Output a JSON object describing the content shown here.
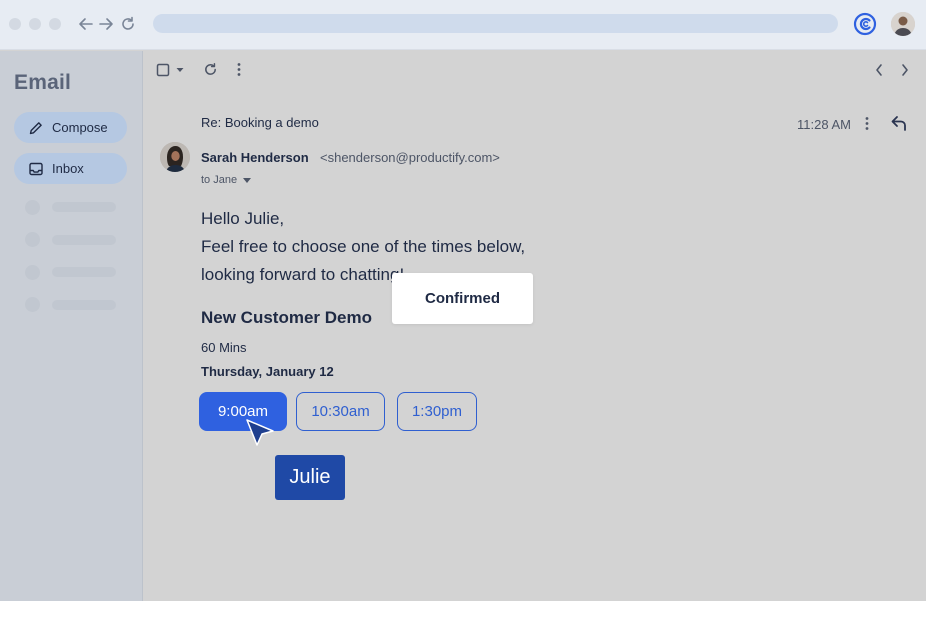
{
  "browser": {
    "icons": [
      "arrow-left-icon",
      "arrow-right-icon",
      "reload-icon",
      "brand-logo-icon",
      "user-avatar"
    ]
  },
  "sidebar": {
    "title": "Email",
    "compose_label": "Compose",
    "inbox_label": "Inbox",
    "placeholder_items": 4
  },
  "toolbar": {
    "icons": [
      "checkbox-icon",
      "dropdown-caret-icon",
      "refresh-icon",
      "more-vertical-icon",
      "chevron-left-icon",
      "chevron-right-icon"
    ]
  },
  "message": {
    "subject": "Re: Booking a demo",
    "time": "11:28 AM",
    "sender_name": "Sarah Henderson",
    "sender_email": "<shenderson@productify.com>",
    "to_line": "to Jane",
    "body_lines": [
      "Hello Julie,",
      "Feel free to choose one of the times below,",
      "looking forward to chatting!"
    ]
  },
  "event": {
    "title": "New Customer Demo",
    "duration": "60 Mins",
    "date": "Thursday, January 12",
    "slots": [
      {
        "label": "9:00am",
        "selected": true
      },
      {
        "label": "10:30am",
        "selected": false
      },
      {
        "label": "1:30pm",
        "selected": false
      }
    ]
  },
  "overlay": {
    "confirmed_label": "Confirmed",
    "cursor_name": "Julie"
  },
  "colors": {
    "accent": "#2f61e0",
    "name_tag": "#1f49a6",
    "sidebar_button": "#b5c8e2"
  }
}
